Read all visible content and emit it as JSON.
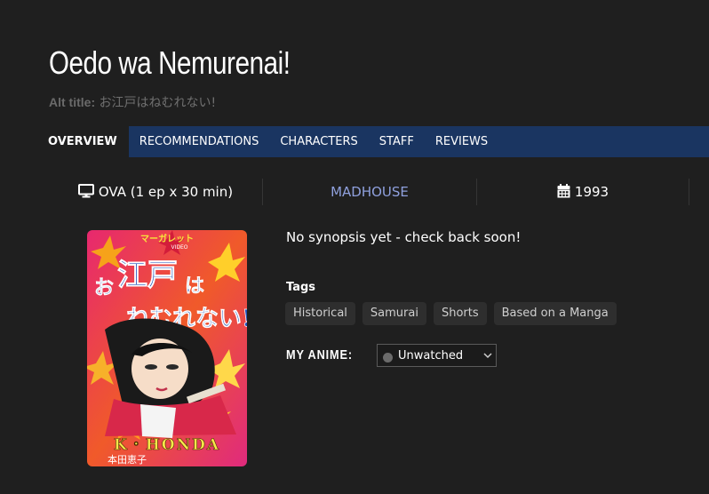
{
  "anime": {
    "title": "Oedo wa Nemurenai!",
    "alt_title_label": "Alt title:",
    "alt_title": "お江戸はねむれない!"
  },
  "nav": {
    "tabs": [
      {
        "label": "OVERVIEW",
        "active": true
      },
      {
        "label": "RECOMMENDATIONS"
      },
      {
        "label": "CHARACTERS"
      },
      {
        "label": "STAFF"
      },
      {
        "label": "REVIEWS"
      }
    ]
  },
  "info": {
    "format": "OVA (1 ep x 30 min)",
    "format_icon": "monitor-icon",
    "studio": "MADHOUSE",
    "year": "1993",
    "year_icon": "calendar-icon"
  },
  "poster": {
    "publisher_label": "マーガレット VIDEO",
    "author": "K・HONDA",
    "author_jp": "本田恵子"
  },
  "synopsis": "No synopsis yet - check back soon!",
  "tags": {
    "label": "Tags",
    "items": [
      "Historical",
      "Samurai",
      "Shorts",
      "Based on a Manga"
    ]
  },
  "my_anime": {
    "label": "MY ANIME:",
    "status": "Unwatched",
    "status_color": "#6b6b6b"
  },
  "colors": {
    "background": "#1f1f1f",
    "nav_bar": "#1a3561",
    "studio_link": "#8fa0dd",
    "tag_bg": "#2e2e2e"
  }
}
